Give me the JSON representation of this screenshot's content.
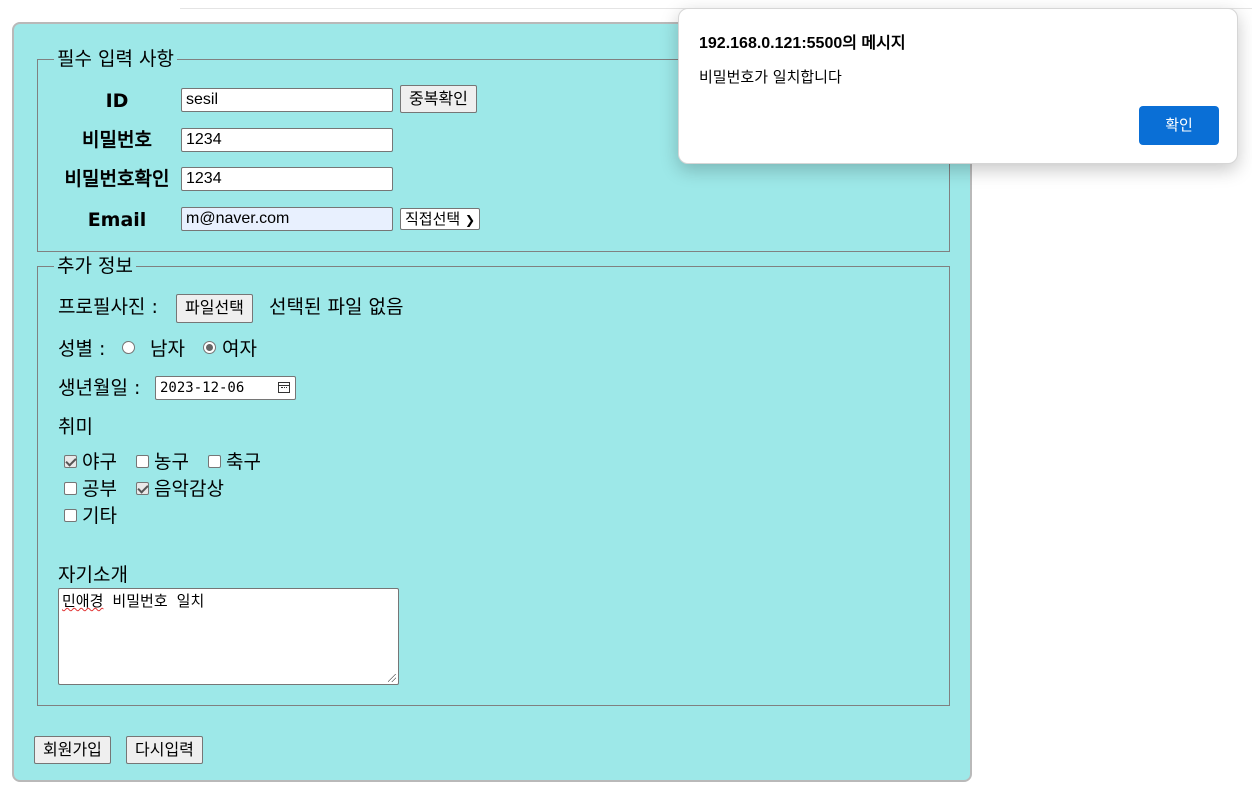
{
  "dialog": {
    "title": "192.168.0.121:5500의 메시지",
    "message": "비밀번호가 일치합니다",
    "ok_label": "확인"
  },
  "required": {
    "legend": "필수 입력 사항",
    "id_label": "ID",
    "id_value": "sesil",
    "dup_check_label": "중복확인",
    "pw_label": "비밀번호",
    "pw_value": "1234",
    "pw_confirm_label": "비밀번호확인",
    "pw_confirm_value": "1234",
    "email_label": "Email",
    "email_value": "m@naver.com",
    "email_domain_selected": "직접선택"
  },
  "extra": {
    "legend": "추가 정보",
    "photo_label": "프로필사진 :",
    "file_button": "파일선택",
    "file_status": "선택된 파일 없음",
    "gender_label": "성별 :",
    "gender_options": [
      {
        "label": "남자",
        "checked": false
      },
      {
        "label": "여자",
        "checked": true
      }
    ],
    "birth_label": "생년월일 :",
    "birth_value": "2023-12-06",
    "hobby_label": "취미",
    "hobbies": [
      {
        "label": "야구",
        "checked": true
      },
      {
        "label": "농구",
        "checked": false
      },
      {
        "label": "축구",
        "checked": false
      },
      {
        "label": "공부",
        "checked": false
      },
      {
        "label": "음악감상",
        "checked": true
      },
      {
        "label": "기타",
        "checked": false
      }
    ],
    "intro_label": "자기소개",
    "intro_misspelled": "민애경",
    "intro_rest": " 비밀번호 일치"
  },
  "actions": {
    "submit_label": "회원가입",
    "reset_label": "다시입력"
  }
}
